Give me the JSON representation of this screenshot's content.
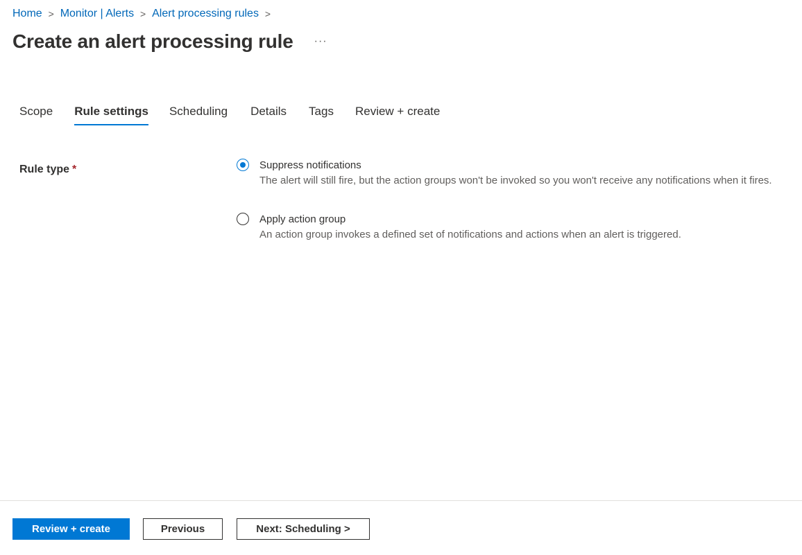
{
  "breadcrumb": {
    "items": [
      {
        "label": "Home"
      },
      {
        "label": "Monitor | Alerts"
      },
      {
        "label": "Alert processing rules"
      }
    ],
    "separator": ">"
  },
  "header": {
    "title": "Create an alert processing rule",
    "more_label": "···"
  },
  "tabs": [
    {
      "label": "Scope",
      "active": false
    },
    {
      "label": "Rule settings",
      "active": true
    },
    {
      "label": "Scheduling",
      "active": false
    },
    {
      "label": "Details",
      "active": false
    },
    {
      "label": "Tags",
      "active": false
    },
    {
      "label": "Review + create",
      "active": false
    }
  ],
  "rule_type": {
    "label": "Rule type",
    "required_mark": "*",
    "options": [
      {
        "label": "Suppress notifications",
        "description": "The alert will still fire, but the action groups won't be invoked so you won't receive any notifications when it fires.",
        "selected": true
      },
      {
        "label": "Apply action group",
        "description": "An action group invokes a defined set of notifications and actions when an alert is triggered.",
        "selected": false
      }
    ]
  },
  "footer": {
    "review_create_label": "Review + create",
    "previous_label": "Previous",
    "next_label": "Next: Scheduling >"
  },
  "colors": {
    "accent": "#0078d4",
    "link": "#0067b8",
    "required": "#a4262c"
  }
}
